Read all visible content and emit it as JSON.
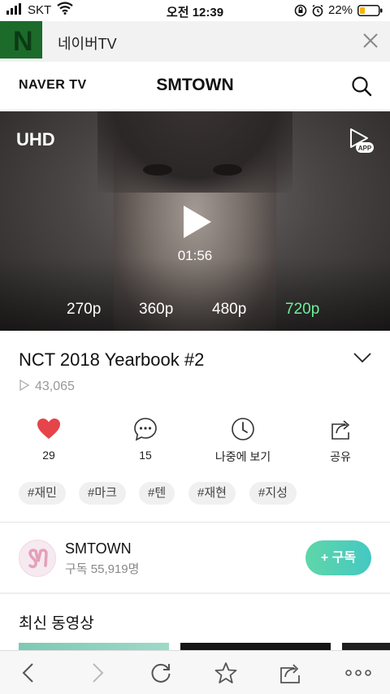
{
  "status_bar": {
    "carrier": "SKT",
    "time": "오전 12:39",
    "battery": "22%"
  },
  "app_header": {
    "title": "네이버TV"
  },
  "nav_header": {
    "brand": "NAVER TV",
    "channel": "SMTOWN"
  },
  "video": {
    "badge": "UHD",
    "duration": "01:56",
    "qualities": [
      "270p",
      "360p",
      "480p",
      "720p"
    ],
    "selected_quality": "720p",
    "accent_color": "#6cf09a"
  },
  "info": {
    "title": "NCT 2018 Yearbook #2",
    "views": "43,065"
  },
  "actions": [
    {
      "icon": "heart-icon",
      "label": "29"
    },
    {
      "icon": "comment-icon",
      "label": "15"
    },
    {
      "icon": "clock-icon",
      "label": "나중에 보기"
    },
    {
      "icon": "share-icon",
      "label": "공유"
    }
  ],
  "tags": [
    "#재민",
    "#마크",
    "#텐",
    "#재현",
    "#지성"
  ],
  "channel": {
    "name": "SMTOWN",
    "subscribers": "구독 55,919명",
    "subscribe_label": "+ 구독"
  },
  "section": {
    "title": "최신 동영상"
  },
  "colors": {
    "heart": "#e5444a",
    "subscribe_gradient_start": "#5fd6a9",
    "subscribe_gradient_end": "#45c8c2"
  }
}
